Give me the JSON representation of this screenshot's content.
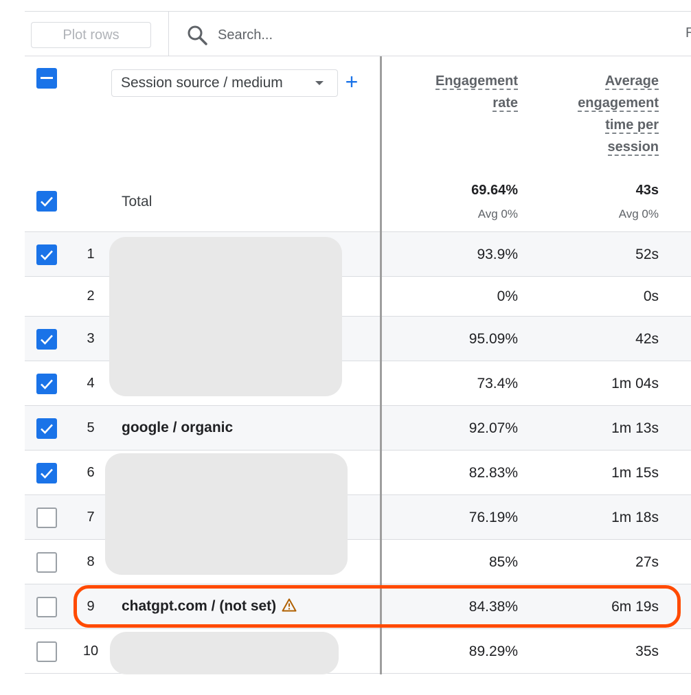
{
  "toolbar": {
    "plot_rows_label": "Plot rows",
    "search_placeholder": "Search...",
    "cut_text": "R"
  },
  "table": {
    "dimension_select_label": "Session source / medium",
    "add_dimension_label": "+",
    "columns": [
      {
        "lines": [
          "Engagement",
          "rate"
        ]
      },
      {
        "lines": [
          "Average",
          "engagement",
          "time per",
          "session"
        ]
      }
    ],
    "totals": {
      "label": "Total",
      "values": [
        "69.64%",
        "43s"
      ],
      "subs": [
        "Avg 0%",
        "Avg 0%"
      ]
    },
    "rows": [
      {
        "num": "1",
        "name": "",
        "engagement_rate": "93.9%",
        "avg_time": "52s",
        "checked": true,
        "shaded": true
      },
      {
        "num": "2",
        "name": "",
        "engagement_rate": "0%",
        "avg_time": "0s",
        "checked": null,
        "shaded": false
      },
      {
        "num": "3",
        "name": "",
        "engagement_rate": "95.09%",
        "avg_time": "42s",
        "checked": true,
        "shaded": true
      },
      {
        "num": "4",
        "name": "",
        "engagement_rate": "73.4%",
        "avg_time": "1m 04s",
        "checked": true,
        "shaded": false
      },
      {
        "num": "5",
        "name": "google / organic",
        "engagement_rate": "92.07%",
        "avg_time": "1m 13s",
        "checked": true,
        "shaded": true
      },
      {
        "num": "6",
        "name": "",
        "engagement_rate": "82.83%",
        "avg_time": "1m 15s",
        "checked": true,
        "shaded": false
      },
      {
        "num": "7",
        "name": "",
        "engagement_rate": "76.19%",
        "avg_time": "1m 18s",
        "checked": false,
        "shaded": true
      },
      {
        "num": "8",
        "name": "",
        "engagement_rate": "85%",
        "avg_time": "27s",
        "checked": false,
        "shaded": false
      },
      {
        "num": "9",
        "name": "chatgpt.com / (not set)",
        "engagement_rate": "84.38%",
        "avg_time": "6m 19s",
        "checked": false,
        "shaded": true,
        "warning": true
      },
      {
        "num": "10",
        "name": "",
        "engagement_rate": "89.29%",
        "avg_time": "35s",
        "checked": false,
        "shaded": false
      }
    ]
  },
  "colors": {
    "accent": "#1a73e8",
    "highlight": "#ff4a00",
    "warning": "#b06000"
  }
}
